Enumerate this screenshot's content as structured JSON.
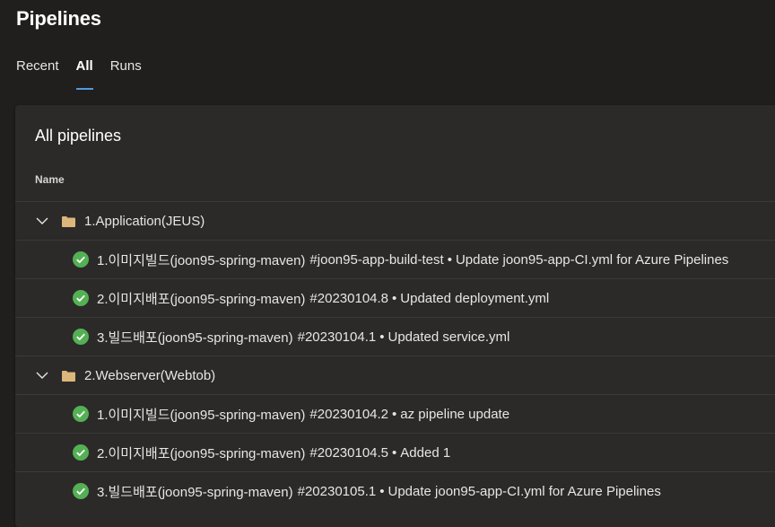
{
  "page": {
    "title": "Pipelines"
  },
  "tabs": [
    {
      "label": "Recent",
      "active": false
    },
    {
      "label": "All",
      "active": true
    },
    {
      "label": "Runs",
      "active": false
    }
  ],
  "card": {
    "title": "All pipelines",
    "column_header": "Name"
  },
  "colors": {
    "accent": "#4f9bdc",
    "success": "#54b054",
    "folder": "#dcb67a"
  },
  "groups": [
    {
      "name": "1.Application(JEUS)",
      "items": [
        {
          "name": "1.이미지빌드(joon95-spring-maven)",
          "run": "#joon95-app-build-test",
          "commit": "Update joon95-app-CI.yml for Azure Pipelines",
          "status": "succeeded"
        },
        {
          "name": "2.이미지배포(joon95-spring-maven)",
          "run": "#20230104.8",
          "commit": "Updated deployment.yml",
          "status": "succeeded"
        },
        {
          "name": "3.빌드배포(joon95-spring-maven)",
          "run": "#20230104.1",
          "commit": "Updated service.yml",
          "status": "succeeded"
        }
      ]
    },
    {
      "name": "2.Webserver(Webtob)",
      "items": [
        {
          "name": "1.이미지빌드(joon95-spring-maven)",
          "run": "#20230104.2",
          "commit": "az pipeline update",
          "status": "succeeded"
        },
        {
          "name": "2.이미지배포(joon95-spring-maven)",
          "run": "#20230104.5",
          "commit": "Added 1",
          "status": "succeeded"
        },
        {
          "name": "3.빌드배포(joon95-spring-maven)",
          "run": "#20230105.1",
          "commit": "Update joon95-app-CI.yml for Azure Pipelines",
          "status": "succeeded"
        }
      ]
    }
  ]
}
